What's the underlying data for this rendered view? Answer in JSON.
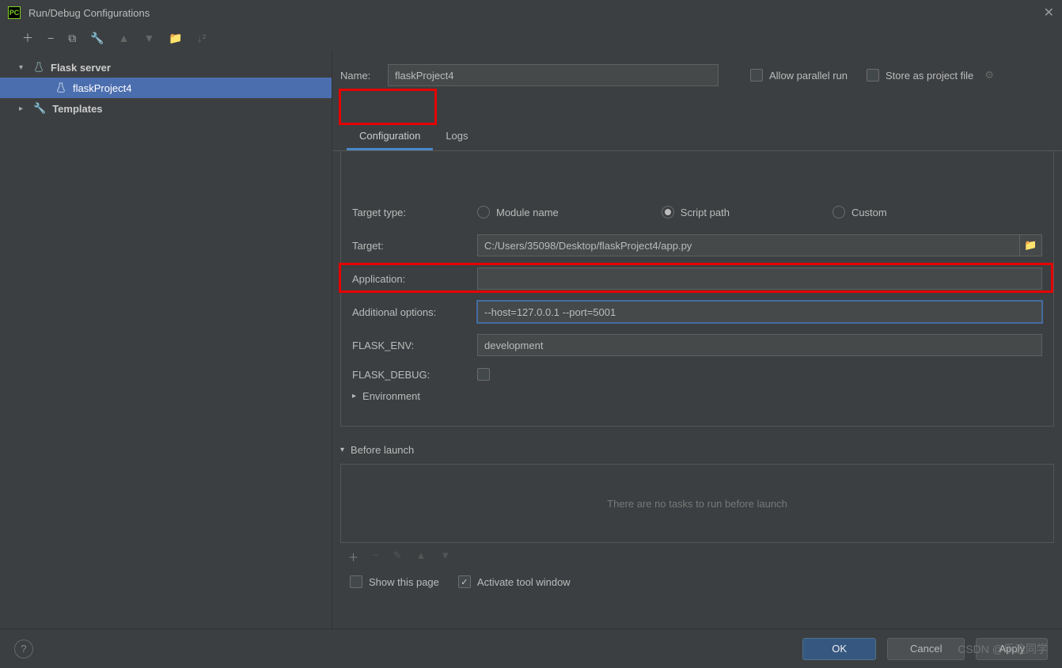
{
  "window": {
    "title": "Run/Debug Configurations"
  },
  "sidebar": {
    "items": [
      {
        "label": "Flask server",
        "type": "group",
        "expanded": true
      },
      {
        "label": "flaskProject4",
        "type": "config",
        "selected": true
      },
      {
        "label": "Templates",
        "type": "group",
        "expanded": false
      }
    ]
  },
  "form": {
    "name_label": "Name:",
    "name_value": "flaskProject4",
    "allow_parallel": "Allow parallel run",
    "store_as_file": "Store as project file"
  },
  "tabs": {
    "configuration": "Configuration",
    "logs": "Logs"
  },
  "fields": {
    "target_type_label": "Target type:",
    "radio_module": "Module name",
    "radio_script": "Script path",
    "radio_custom": "Custom",
    "target_label": "Target:",
    "target_value": "C:/Users/35098/Desktop/flaskProject4/app.py",
    "application_label": "Application:",
    "application_value": "",
    "additional_label": "Additional options:",
    "additional_value": "--host=127.0.0.1 --port=5001",
    "flask_env_label": "FLASK_ENV:",
    "flask_env_value": "development",
    "flask_debug_label": "FLASK_DEBUG:",
    "environment_label": "Environment"
  },
  "before": {
    "header": "Before launch",
    "empty": "There are no tasks to run before launch"
  },
  "footer": {
    "show_page": "Show this page",
    "activate_tool": "Activate tool window"
  },
  "buttons": {
    "ok": "OK",
    "cancel": "Cancel",
    "apply": "Apply"
  },
  "watermark": "CSDN @乐途同学"
}
